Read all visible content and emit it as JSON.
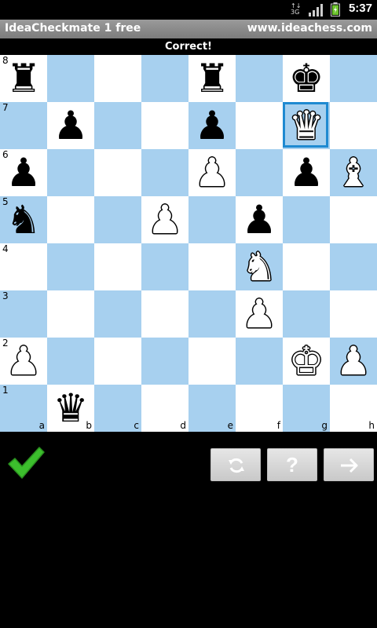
{
  "status_bar": {
    "time": "5:37",
    "network": "3G",
    "network_sub": "↑↓"
  },
  "title_bar": {
    "app_name": "IdeaCheckmate 1 free",
    "website": "www.ideachess.com"
  },
  "message": "Correct!",
  "board": {
    "ranks": [
      "8",
      "7",
      "6",
      "5",
      "4",
      "3",
      "2",
      "1"
    ],
    "files": [
      "a",
      "b",
      "c",
      "d",
      "e",
      "f",
      "g",
      "h"
    ],
    "highlight_square": "g7",
    "pieces": [
      {
        "square": "a8",
        "glyph": "♜",
        "color": "black",
        "name": "black-rook"
      },
      {
        "square": "e8",
        "glyph": "♜",
        "color": "black",
        "name": "black-rook"
      },
      {
        "square": "g8",
        "glyph": "♚",
        "color": "black",
        "name": "black-king"
      },
      {
        "square": "b7",
        "glyph": "♟",
        "color": "black",
        "name": "black-pawn"
      },
      {
        "square": "e7",
        "glyph": "♟",
        "color": "black",
        "name": "black-pawn"
      },
      {
        "square": "g7",
        "glyph": "♛",
        "color": "white",
        "name": "white-queen"
      },
      {
        "square": "a6",
        "glyph": "♟",
        "color": "black",
        "name": "black-pawn"
      },
      {
        "square": "e6",
        "glyph": "♟",
        "color": "white",
        "name": "white-pawn"
      },
      {
        "square": "g6",
        "glyph": "♟",
        "color": "black",
        "name": "black-pawn"
      },
      {
        "square": "h6",
        "glyph": "♝",
        "color": "white",
        "name": "white-bishop"
      },
      {
        "square": "a5",
        "glyph": "♞",
        "color": "black",
        "name": "black-knight"
      },
      {
        "square": "d5",
        "glyph": "♟",
        "color": "white",
        "name": "white-pawn"
      },
      {
        "square": "f5",
        "glyph": "♟",
        "color": "black",
        "name": "black-pawn"
      },
      {
        "square": "f4",
        "glyph": "♞",
        "color": "white",
        "name": "white-knight"
      },
      {
        "square": "f3",
        "glyph": "♟",
        "color": "white",
        "name": "white-pawn"
      },
      {
        "square": "a2",
        "glyph": "♟",
        "color": "white",
        "name": "white-pawn"
      },
      {
        "square": "g2",
        "glyph": "♚",
        "color": "white",
        "name": "white-king"
      },
      {
        "square": "h2",
        "glyph": "♟",
        "color": "white",
        "name": "white-pawn"
      },
      {
        "square": "b1",
        "glyph": "♛",
        "color": "black",
        "name": "black-queen"
      }
    ]
  },
  "controls": {
    "result_icon": "checkmark-icon",
    "buttons": [
      {
        "name": "refresh-button",
        "icon": "refresh-icon"
      },
      {
        "name": "hint-button",
        "icon": "question-icon",
        "label": "?"
      },
      {
        "name": "next-button",
        "icon": "arrow-right-icon"
      }
    ]
  },
  "colors": {
    "dark_square": "#a7d0ef",
    "light_square": "#ffffff",
    "highlight": "#1f8ad1",
    "check_green": "#3cbf2d"
  }
}
